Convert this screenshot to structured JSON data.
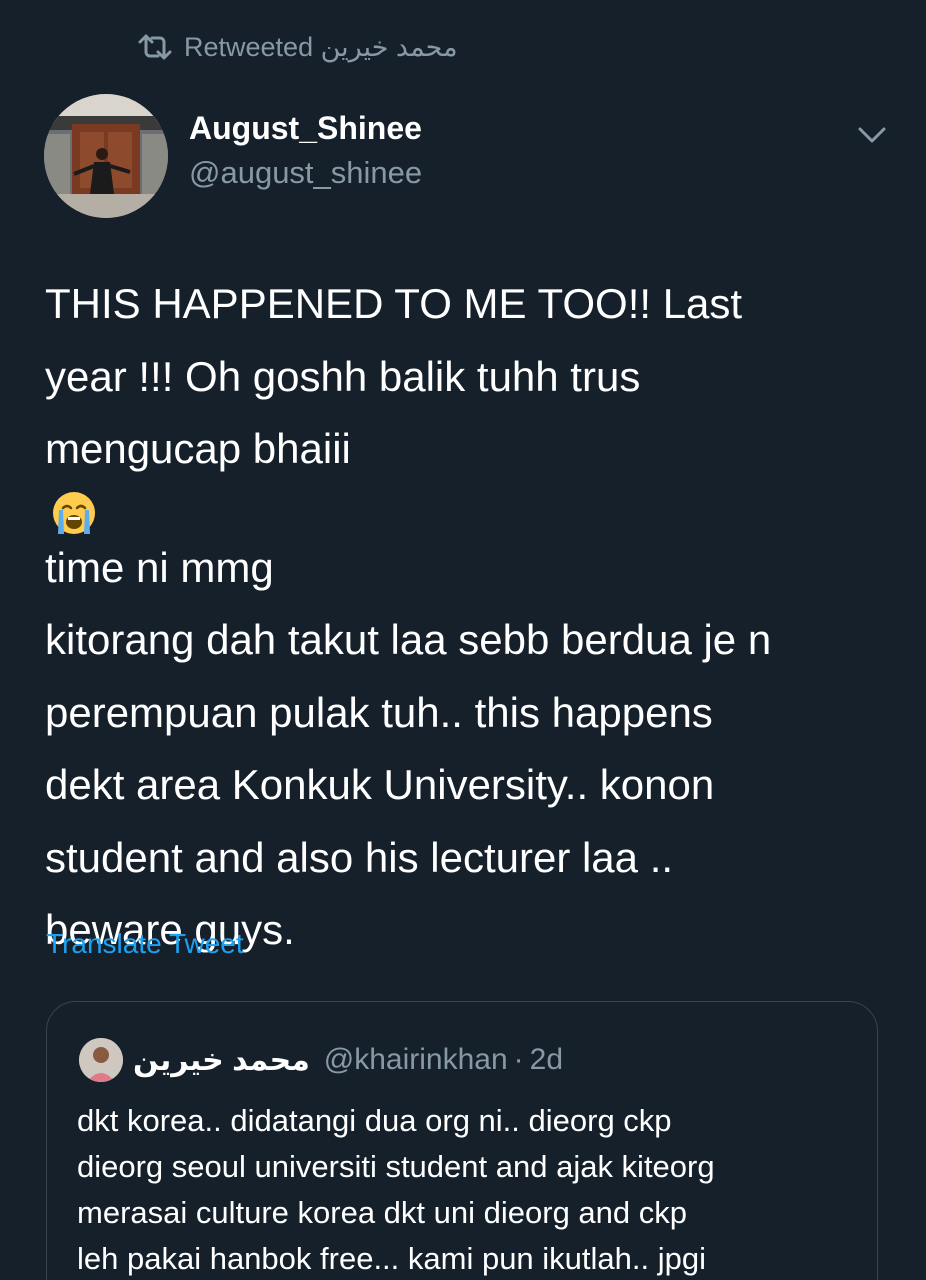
{
  "retweet": {
    "icon": "retweet-icon",
    "text": "محمد خيرين Retweeted"
  },
  "tweet": {
    "author_name": "August_Shinee",
    "author_handle": "@august_shinee",
    "menu_icon": "chevron-down-icon",
    "text_lines": [
      "THIS HAPPENED TO ME TOO!! Last",
      "year !!! Oh goshh balik tuhh trus",
      "mengucap bhaiii",
      "time ni mmg",
      "kitorang dah takut laa sebb berdua je n",
      "perempuan pulak tuh.. this happens",
      "dekt area Konkuk University.. konon",
      "student and also his lecturer laa ..",
      "beware guys."
    ],
    "emoji": "loudly-crying-face-icon",
    "translate_label": "Translate Tweet"
  },
  "quoted": {
    "name": "محمد خيرين",
    "handle": "@khairinkhan",
    "separator": "·",
    "time": "2d",
    "text_lines": [
      "dkt korea.. didatangi dua org ni.. dieorg ckp",
      "dieorg seoul universiti student and ajak kiteorg",
      "merasai culture korea dkt uni dieorg and ckp",
      "leh pakai hanbok free... kami pun ikutlah.. jpgi"
    ]
  },
  "colors": {
    "background": "#15202b",
    "primary_text": "#ffffff",
    "secondary_text": "#8899a6",
    "link": "#1da1f2",
    "border": "#38444d"
  }
}
